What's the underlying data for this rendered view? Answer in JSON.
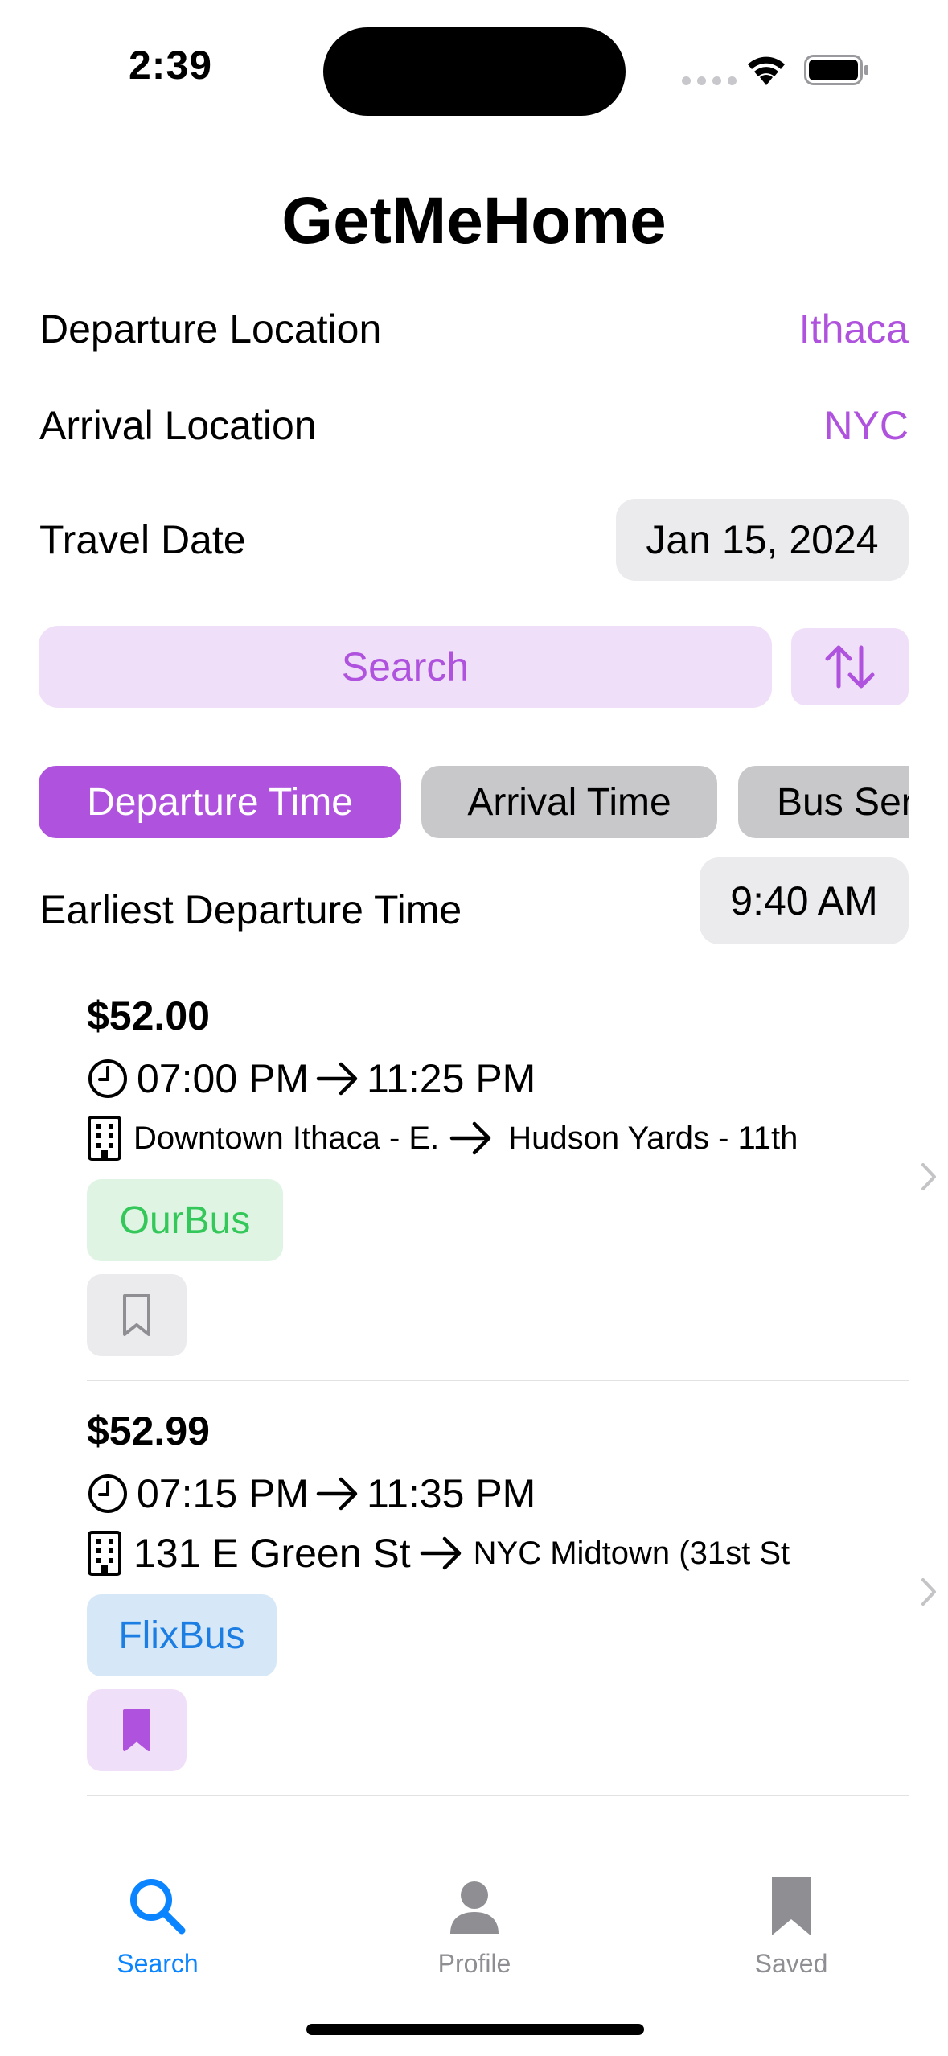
{
  "status_bar": {
    "time": "2:39"
  },
  "app": {
    "title": "GetMeHome"
  },
  "form": {
    "departure_label": "Departure Location",
    "departure_value": "Ithaca",
    "arrival_label": "Arrival Location",
    "arrival_value": "NYC",
    "date_label": "Travel Date",
    "date_value": "Jan 15, 2024",
    "search_label": "Search",
    "swap_icon": "arrow-up-arrow-down-icon"
  },
  "sort_chips": {
    "items": [
      {
        "label": "Departure Time",
        "active": true
      },
      {
        "label": "Arrival Time",
        "active": false
      },
      {
        "label": "Bus Ser",
        "active": false
      }
    ]
  },
  "filter": {
    "label": "Earliest Departure Time",
    "value": "9:40 AM"
  },
  "results": [
    {
      "price": "$52.00",
      "depart_time": "07:00 PM",
      "arrive_time": "11:25 PM",
      "from_stop": "Downtown Ithaca - E.",
      "to_stop": "Hudson Yards - 11th",
      "carrier": "OurBus",
      "saved": false
    },
    {
      "price": "$52.99",
      "depart_time": "07:15 PM",
      "arrive_time": "11:35 PM",
      "from_stop": "131 E Green St",
      "to_stop": "NYC Midtown (31st St",
      "carrier": "FlixBus",
      "saved": true
    }
  ],
  "tabbar": {
    "items": [
      {
        "label": "Search",
        "icon": "magnifying-glass-icon",
        "active": true
      },
      {
        "label": "Profile",
        "icon": "person-icon",
        "active": false
      },
      {
        "label": "Saved",
        "icon": "bookmark-icon",
        "active": false
      }
    ]
  },
  "colors": {
    "accent": "#af52de",
    "accent_bg": "#f0dff8",
    "ourbus_text": "#34c759",
    "ourbus_bg": "#dff4e3",
    "flixbus_text": "#1c7ee3",
    "flixbus_bg": "#d6e8f8",
    "tab_active": "#0a84ff",
    "tab_inactive": "#8e8e93"
  }
}
